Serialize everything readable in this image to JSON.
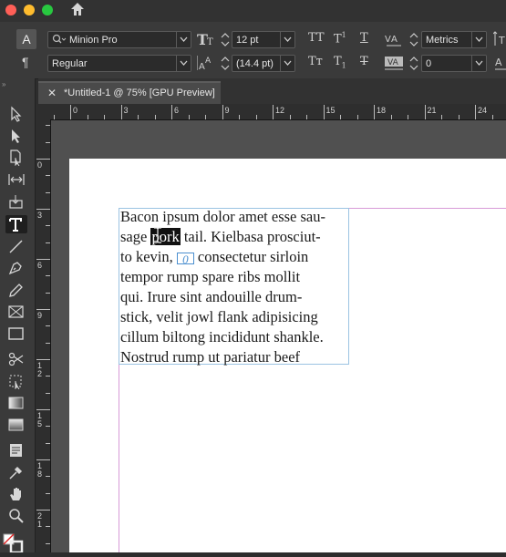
{
  "window": {
    "colors": {
      "close": "#ff5f57",
      "minimize": "#febc2e",
      "maximize": "#28c840"
    }
  },
  "control": {
    "char_button": "A",
    "para_button": "¶",
    "font_family": "Minion Pro",
    "font_style": "Regular",
    "font_size": "12 pt",
    "leading": "(14.4 pt)",
    "kerning": "Metrics",
    "tracking": "0",
    "icons": {
      "all_caps": "TT",
      "superscript": "T",
      "superscript_mark": "1",
      "underline": "T",
      "small_caps": "Tᴛ",
      "subscript": "T",
      "subscript_mark": "1",
      "strikethrough": "T"
    }
  },
  "tab": {
    "close": "✕",
    "title": "*Untitled-1 @ 75% [GPU Preview]"
  },
  "ruler": {
    "h_labels": [
      "0",
      "3",
      "6",
      "9",
      "12",
      "15",
      "18",
      "21",
      "24"
    ],
    "v_labels": [
      "0",
      "3",
      "6",
      "9",
      "1\n2",
      "1\n5",
      "1\n8",
      "2\n1"
    ]
  },
  "text_frame": {
    "lines": [
      {
        "text": "Bacon ipsum dolor amet esse sau-"
      },
      {
        "before": "sage ",
        "highlight": "pork",
        "after": " tail. Kielbasa prosciut-"
      },
      {
        "before": "to kevin, ",
        "anchor": "0",
        "after": "consectetur sirloin"
      },
      {
        "text": "tempor rump spare ribs mollit"
      },
      {
        "text": "qui. Irure sint andouille drum-"
      },
      {
        "text": "stick, velit jowl flank adipisicing"
      },
      {
        "text": "cillum biltong incididunt shankle."
      },
      {
        "text": "Nostrud rump ut pariatur beef"
      }
    ]
  },
  "colors": {
    "guide": "#d79ad7",
    "frame": "#9bc3e2",
    "page": "#ffffff",
    "pasteboard": "#505050"
  }
}
